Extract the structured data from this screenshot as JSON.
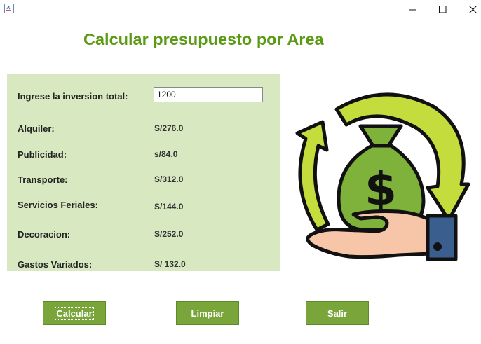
{
  "window": {
    "title_icon": "java-cup-icon"
  },
  "header": {
    "title": "Calcular presupuesto por Area"
  },
  "form": {
    "inversion_label": "Ingrese la inversion total:",
    "inversion_value": "1200",
    "rows": [
      {
        "label": "Alquiler:",
        "value": "S/276.0"
      },
      {
        "label": "Publicidad:",
        "value": "s/84.0"
      },
      {
        "label": "Transporte:",
        "value": "S/312.0"
      },
      {
        "label": "Servicios Feriales:",
        "value": "S/144.0"
      },
      {
        "label": "Decoracion:",
        "value": "S/252.0"
      },
      {
        "label": "Gastos Variados:",
        "value": "S/ 132.0"
      }
    ]
  },
  "buttons": {
    "calcular": "Calcular",
    "limpiar": "Limpiar",
    "salir": "Salir"
  },
  "colors": {
    "title": "#5b9a14",
    "panel": "#d8e9c2",
    "button": "#79a53a"
  },
  "illustration": {
    "icon": "money-bag-hand-cycle-icon"
  }
}
